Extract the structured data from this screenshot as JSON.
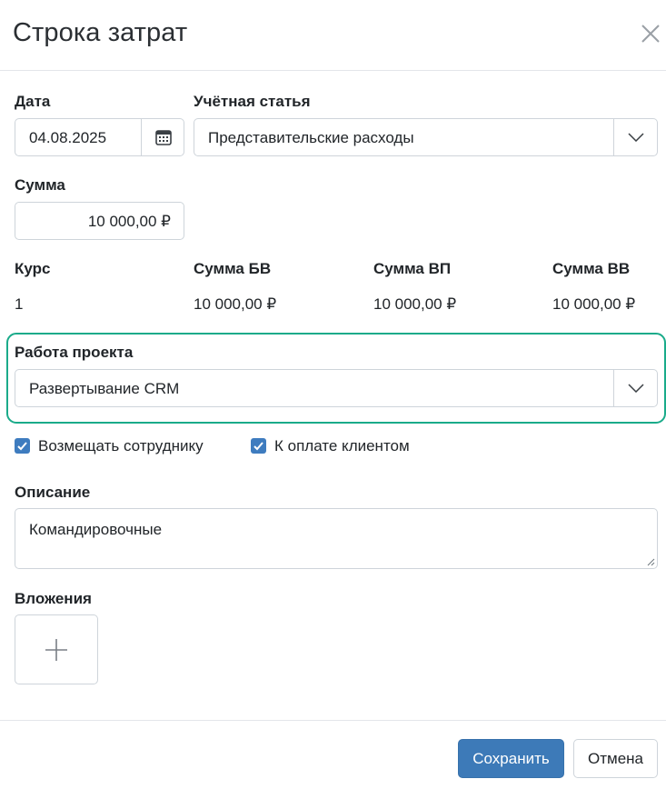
{
  "dialog": {
    "title": "Строка затрат"
  },
  "date": {
    "label": "Дата",
    "value": "04.08.2025"
  },
  "account": {
    "label": "Учётная статья",
    "value": "Представительские расходы"
  },
  "amount": {
    "label": "Сумма",
    "value": "10 000,00 ₽"
  },
  "rates": [
    {
      "label": "Курс",
      "value": "1"
    },
    {
      "label": "Сумма БВ",
      "value": "10 000,00 ₽"
    },
    {
      "label": "Сумма ВП",
      "value": "10 000,00 ₽"
    },
    {
      "label": "Сумма ВВ",
      "value": "10 000,00 ₽"
    }
  ],
  "project_work": {
    "label": "Работа проекта",
    "value": "Развертывание CRM"
  },
  "checkboxes": [
    {
      "label": "Возмещать сотруднику",
      "checked": true
    },
    {
      "label": "К оплате клиентом",
      "checked": true
    }
  ],
  "description": {
    "label": "Описание",
    "value": "Командировочные"
  },
  "attachments": {
    "label": "Вложения"
  },
  "footer": {
    "save_label": "Сохранить",
    "cancel_label": "Отмена"
  },
  "colors": {
    "primary": "#3d7ab8",
    "highlight": "#1aab8a",
    "checkbox": "#3e7cbf"
  },
  "icons": {
    "close": "close-icon",
    "calendar": "calendar-icon",
    "dropdown": "chevron-down-icon",
    "add": "plus-icon"
  }
}
